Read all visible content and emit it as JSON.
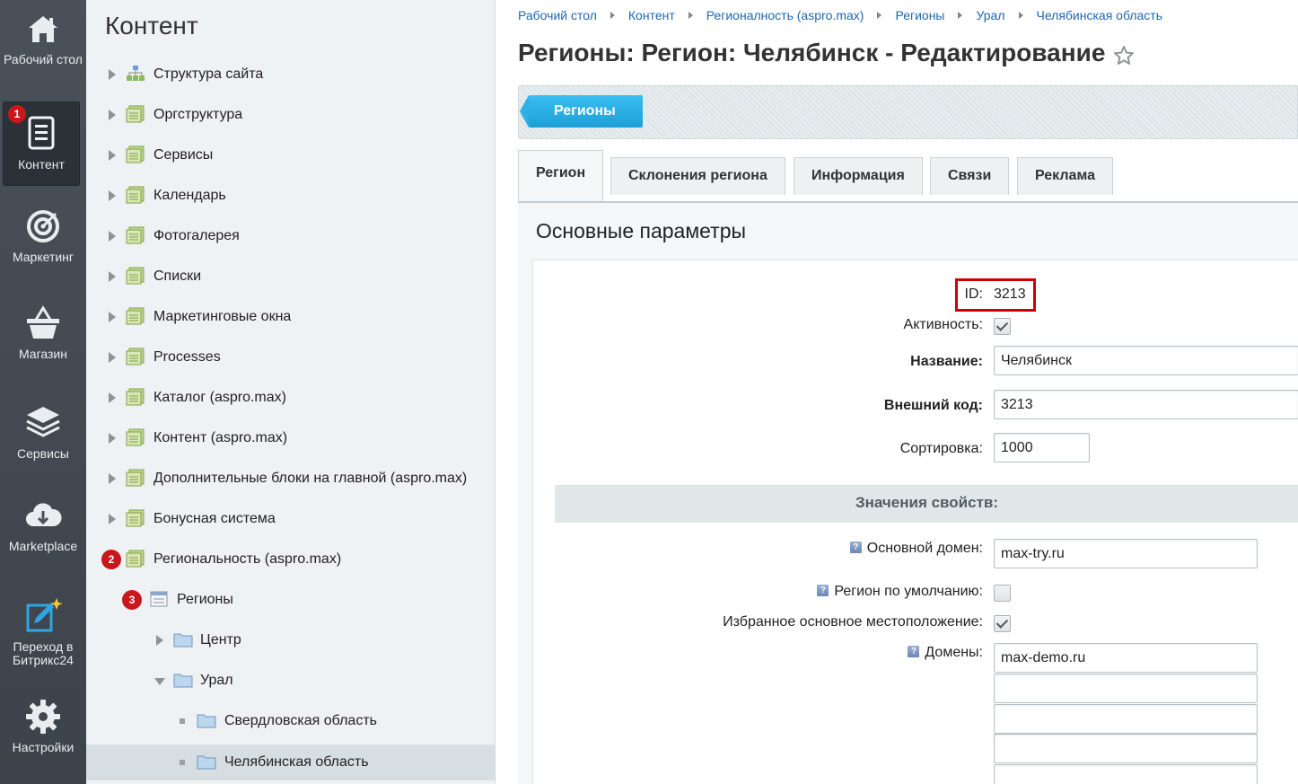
{
  "leftbar": {
    "items": [
      {
        "label": "Рабочий стол",
        "icon": "home-icon"
      },
      {
        "label": "Контент",
        "icon": "document-icon",
        "badge": "1"
      },
      {
        "label": "Маркетинг",
        "icon": "target-icon"
      },
      {
        "label": "Магазин",
        "icon": "basket-icon"
      },
      {
        "label": "Сервисы",
        "icon": "layers-icon"
      },
      {
        "label": "Marketplace",
        "icon": "cloud-download-icon"
      },
      {
        "label": "Переход в Битрикс24",
        "icon": "edit-star-icon"
      },
      {
        "label": "Настройки",
        "icon": "gear-icon"
      }
    ]
  },
  "tree": {
    "title": "Контент",
    "items": [
      {
        "label": "Структура сайта",
        "icon": "sitemap-icon"
      },
      {
        "label": "Оргструктура",
        "icon": "iblock-icon"
      },
      {
        "label": "Сервисы",
        "icon": "iblock-icon"
      },
      {
        "label": "Календарь",
        "icon": "iblock-icon"
      },
      {
        "label": "Фотогалерея",
        "icon": "iblock-icon"
      },
      {
        "label": "Списки",
        "icon": "iblock-icon"
      },
      {
        "label": "Маркетинговые окна",
        "icon": "iblock-icon"
      },
      {
        "label": "Processes",
        "icon": "iblock-icon"
      },
      {
        "label": "Каталог (aspro.max)",
        "icon": "iblock-icon"
      },
      {
        "label": "Контент (aspro.max)",
        "icon": "iblock-icon"
      },
      {
        "label": "Дополнительные блоки на главной (aspro.max)",
        "icon": "iblock-icon"
      },
      {
        "label": "Бонусная система",
        "icon": "iblock-icon"
      },
      {
        "label": "Региональность (aspro.max)",
        "icon": "iblock-icon",
        "badge": "2"
      },
      {
        "label": "Регионы",
        "icon": "list-icon",
        "badge": "3"
      },
      {
        "label": "Центр",
        "icon": "folder-icon"
      },
      {
        "label": "Урал",
        "icon": "folder-icon"
      },
      {
        "label": "Свердловская область",
        "icon": "folder-icon"
      },
      {
        "label": "Челябинская область",
        "icon": "folder-icon"
      }
    ]
  },
  "breadcrumb": [
    "Рабочий стол",
    "Контент",
    "Регионалность (aspro.max)",
    "Регионы",
    "Урал",
    "Челябинская область"
  ],
  "page_title": "Регионы: Регион: Челябинск - Редактирование",
  "toolbar": {
    "back_button": "Регионы"
  },
  "tabs": [
    "Регион",
    "Склонения региона",
    "Информация",
    "Связи",
    "Реклама"
  ],
  "form": {
    "section_title": "Основные параметры",
    "id_label": "ID:",
    "id_value": "3213",
    "active_label": "Активность:",
    "active_checked": true,
    "name_label": "Название:",
    "name_value": "Челябинск",
    "xml_label": "Внешний код:",
    "xml_value": "3213",
    "sort_label": "Сортировка:",
    "sort_value": "1000",
    "props_header": "Значения свойств:",
    "main_domain_label": "Основной домен:",
    "main_domain_value": "max-try.ru",
    "default_region_label": "Регион по умолчанию:",
    "default_region_checked": false,
    "favorite_label": "Избранное основное местоположение:",
    "favorite_checked": true,
    "domains_label": "Домены:",
    "domains_values": [
      "max-demo.ru",
      "",
      "",
      "",
      ""
    ],
    "help_glyph": "?"
  },
  "colors": {
    "accent": "#1ea6dd",
    "link": "#2067b0",
    "badge": "#c8181c",
    "highlight": "#cc0000"
  }
}
